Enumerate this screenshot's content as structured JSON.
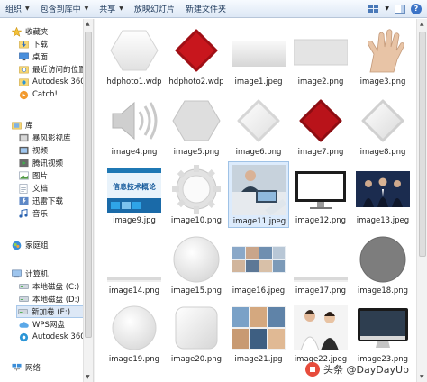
{
  "toolbar": {
    "organize": "组织",
    "include_in_library": "包含到库中",
    "share": "共享",
    "slideshow": "放映幻灯片",
    "new_folder": "新建文件夹"
  },
  "nav": {
    "items": [
      {
        "label": "收藏夹",
        "icon": "star-icon"
      },
      {
        "label": "下载",
        "icon": "download-folder-icon"
      },
      {
        "label": "桌面",
        "icon": "desktop-icon"
      },
      {
        "label": "最近访问的位置",
        "icon": "recent-places-icon"
      },
      {
        "label": "Autodesk 360",
        "icon": "autodesk-icon"
      },
      {
        "label": "Catch!",
        "icon": "catch-icon"
      },
      {
        "label": "库",
        "icon": "library-icon"
      },
      {
        "label": "暴风影视库",
        "icon": "video-library-icon"
      },
      {
        "label": "视频",
        "icon": "video-icon"
      },
      {
        "label": "腾讯视频",
        "icon": "tencent-video-icon"
      },
      {
        "label": "图片",
        "icon": "pictures-icon"
      },
      {
        "label": "文档",
        "icon": "documents-icon"
      },
      {
        "label": "迅雷下载",
        "icon": "thunder-download-icon"
      },
      {
        "label": "音乐",
        "icon": "music-icon"
      },
      {
        "label": "家庭组",
        "icon": "homegroup-icon"
      },
      {
        "label": "计算机",
        "icon": "computer-icon"
      },
      {
        "label": "本地磁盘 (C:)",
        "icon": "drive-icon"
      },
      {
        "label": "本地磁盘 (D:)",
        "icon": "drive-icon"
      },
      {
        "label": "新加卷 (E:)",
        "icon": "drive-icon"
      },
      {
        "label": "WPS网盘",
        "icon": "wps-cloud-icon"
      },
      {
        "label": "Autodesk 360",
        "icon": "autodesk-icon"
      },
      {
        "label": "网络",
        "icon": "network-icon"
      }
    ]
  },
  "files": [
    {
      "name": "hdphoto1.wdp",
      "thumb": "white-hexagon"
    },
    {
      "name": "hdphoto2.wdp",
      "thumb": "red-rhombus"
    },
    {
      "name": "image1.jpeg",
      "thumb": "light-gradient"
    },
    {
      "name": "image2.png",
      "thumb": "grey-rect"
    },
    {
      "name": "image3.png",
      "thumb": "hand"
    },
    {
      "name": "image4.png",
      "thumb": "speaker"
    },
    {
      "name": "image5.png",
      "thumb": "grey-hexagon"
    },
    {
      "name": "image6.png",
      "thumb": "white-rhombus"
    },
    {
      "name": "image7.png",
      "thumb": "red-rhombus"
    },
    {
      "name": "image8.png",
      "thumb": "white-rhombus"
    },
    {
      "name": "image9.jpg",
      "thumb": "book-cover",
      "overlay_text": "信息技术概论"
    },
    {
      "name": "image10.png",
      "thumb": "gear"
    },
    {
      "name": "image11.jpeg",
      "thumb": "office-photo"
    },
    {
      "name": "image12.png",
      "thumb": "monitor"
    },
    {
      "name": "image13.jpeg",
      "thumb": "business-photo"
    },
    {
      "name": "image14.png",
      "thumb": "thin-line"
    },
    {
      "name": "image15.png",
      "thumb": "white-circle"
    },
    {
      "name": "image16.jpeg",
      "thumb": "people-grid"
    },
    {
      "name": "image17.png",
      "thumb": "thin-line"
    },
    {
      "name": "image18.png",
      "thumb": "grey-circle"
    },
    {
      "name": "image19.png",
      "thumb": "white-circle"
    },
    {
      "name": "image20.png",
      "thumb": "rounded-square"
    },
    {
      "name": "image21.jpg",
      "thumb": "people-grid"
    },
    {
      "name": "image22.jpeg",
      "thumb": "women-photo"
    },
    {
      "name": "image23.png",
      "thumb": "imac"
    }
  ],
  "selected_file": "image11.jpeg",
  "watermark": "头条 @DayDayUp",
  "colors": {
    "accent": "#3b73c6",
    "selection": "#dcebfc",
    "red": "#c8161d"
  }
}
